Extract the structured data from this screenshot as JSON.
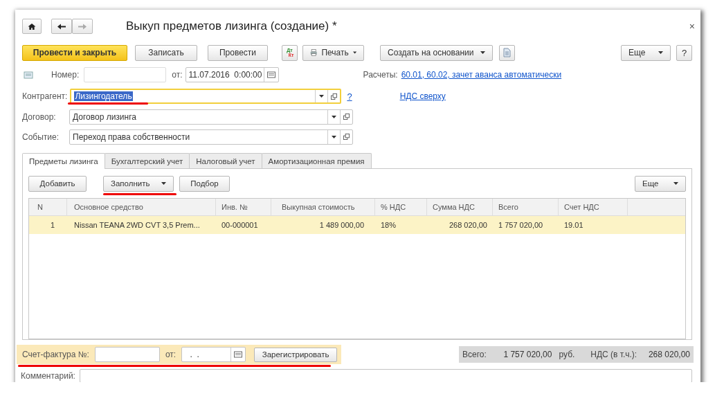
{
  "window": {
    "title": "Выкуп предметов лизинга (создание) *",
    "close": "×"
  },
  "toolbar": [
    {
      "label": "Провести и закрыть",
      "kind": "primary"
    },
    {
      "label": "Записать",
      "kind": "plain"
    },
    {
      "label": "Провести",
      "kind": "plain"
    },
    {
      "kind": "dtkt",
      "label": "Дт Кт"
    },
    {
      "label": "Печать",
      "kind": "print"
    },
    {
      "label": "Создать на основании",
      "kind": "menu"
    },
    {
      "kind": "doc"
    },
    {
      "label": "Еще",
      "kind": "more"
    },
    {
      "label": "?",
      "kind": "plain"
    }
  ],
  "header": {
    "number": {
      "label": "Номер:"
    },
    "date": {
      "label": "от:",
      "value": "11.07.2016  0:00:00"
    },
    "settlements": {
      "label": "Расчеты:",
      "link": "60.01, 60.02, зачет аванса автоматически"
    },
    "vat_link": "НДС сверху",
    "fields": [
      {
        "label": "Контрагент:",
        "value": "Лизингодатель",
        "focused": true,
        "annotated": true,
        "help": "?"
      },
      {
        "label": "Договор:",
        "value": "Договор лизинга",
        "focused": false
      },
      {
        "label": "Событие:",
        "value": "Переход права собственности",
        "focused": false
      }
    ]
  },
  "tabs": [
    {
      "label": "Предметы лизинга",
      "selected": true
    },
    {
      "label": "Бухгалтерский учет",
      "selected": false
    },
    {
      "label": "Налоговый учет",
      "selected": false
    },
    {
      "label": "Амортизационная премия",
      "selected": false
    }
  ],
  "table_toolbar": [
    {
      "label": "Добавить",
      "kind": "plain"
    },
    {
      "label": "Заполнить",
      "kind": "menu",
      "annotated": true
    },
    {
      "label": "Подбор",
      "kind": "plain"
    },
    {
      "label": "Еще",
      "kind": "more"
    }
  ],
  "table": {
    "columns": [
      "N",
      "Основное средство",
      "Инв. №",
      "Выкупная стоимость",
      "% НДС",
      "Сумма НДС",
      "Всего",
      "Счет НДС"
    ],
    "rows": [
      {
        "selected": true,
        "cells": [
          "1",
          "Nissan TEANA 2WD CVT 3,5 Prem...",
          "00-000001",
          "1 489 000,00",
          "18%",
          "268 020,00",
          "1 757 020,00",
          "19.01"
        ]
      }
    ]
  },
  "invoice": {
    "label": "Счет-фактура №:",
    "date_label": "от:",
    "date": " .  .",
    "button": "Зарегистрировать",
    "annotated": true
  },
  "totals": {
    "total_label": "Всего:",
    "total": "1 757 020,00",
    "currency": "руб.",
    "vat_label": "НДС (в т.ч.):",
    "vat": "268 020,00"
  },
  "comment": {
    "label": "Комментарий:"
  }
}
